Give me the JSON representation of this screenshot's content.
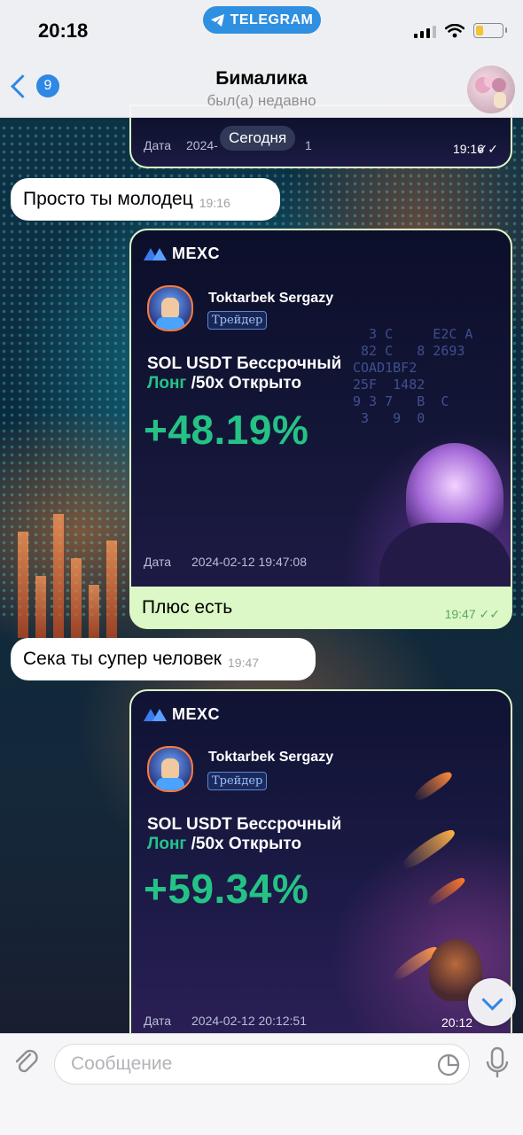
{
  "status_bar": {
    "time": "20:18",
    "source_app": "TELEGRAM"
  },
  "header": {
    "back_badge": "9",
    "title": "Бималика",
    "subtitle": "был(а) недавно"
  },
  "date_separator": "Сегодня",
  "messages": {
    "top_card": {
      "date_label": "Дата",
      "date_value": "2024-",
      "date_suffix": "1",
      "time": "19:16"
    },
    "msg1": {
      "text": "Просто ты молодец",
      "time": "19:16"
    },
    "card1": {
      "brand": "MEXC",
      "trader_name": "Toktarbek Sergazy",
      "trader_tag": "Трейдер",
      "pair_line": "SOL USDT Бессрочный",
      "side": "Лонг",
      "leverage_text": " /50x Открыто",
      "pnl": "+48.19%",
      "date_label": "Дата",
      "date_value": "2024-02-12 19:47:08",
      "caption": "Плюс есть",
      "time": "19:47"
    },
    "msg2": {
      "text": "Сека ты супер человек",
      "time": "19:47"
    },
    "card2": {
      "brand": "MEXC",
      "trader_name": "Toktarbek Sergazy",
      "trader_tag": "Трейдер",
      "pair_line": "SOL USDT Бессрочный",
      "side": "Лонг",
      "leverage_text": " /50x Открыто",
      "pnl": "+59.34%",
      "date_label": "Дата",
      "date_value": "2024-02-12 20:12:51",
      "time": "20:12"
    }
  },
  "input": {
    "placeholder": "Сообщение"
  },
  "colors": {
    "accent": "#2f87e6",
    "outgoing": "#dcf8c6",
    "profit_green": "#25c286"
  }
}
